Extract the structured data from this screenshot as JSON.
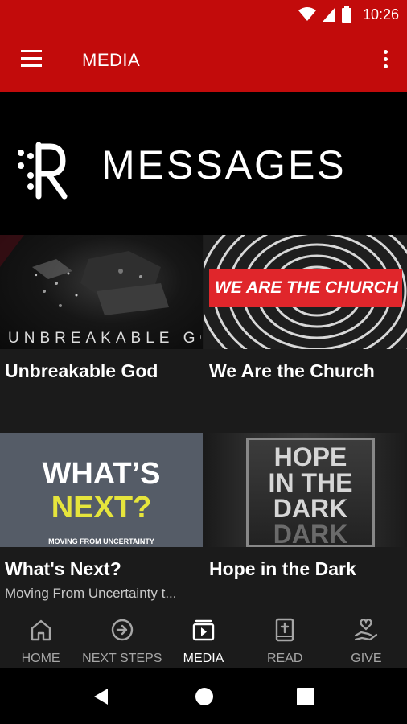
{
  "status_bar": {
    "time": "10:26",
    "bg_color": "#c20b0b"
  },
  "app_bar": {
    "title": "MEDIA",
    "menu_icon": "hamburger-menu-icon",
    "overflow_icon": "more-vert-icon",
    "bg_color": "#c20b0b"
  },
  "banner": {
    "logo": "R",
    "title": "MESSAGES"
  },
  "series": [
    {
      "title": "Unbreakable God",
      "subtitle": "",
      "art_text": "UNBREAKABLE GOD"
    },
    {
      "title": "We Are the Church",
      "subtitle": "",
      "art_text": "WE ARE THE CHURCH"
    },
    {
      "title": "What's Next?",
      "subtitle": "Moving From Uncertainty t...",
      "art_line1": "WHAT’S",
      "art_line2": "NEXT?",
      "art_caption": "MOVING FROM UNCERTAINTY"
    },
    {
      "title": "Hope in the Dark",
      "subtitle": "",
      "art_lines": [
        "HOPE",
        "IN THE",
        "DARK",
        "DARK"
      ]
    }
  ],
  "bottom_nav": {
    "items": [
      {
        "label": "HOME",
        "icon": "home-icon"
      },
      {
        "label": "NEXT STEPS",
        "icon": "arrow-circle-right-icon"
      },
      {
        "label": "MEDIA",
        "icon": "media-play-icon",
        "active": true
      },
      {
        "label": "READ",
        "icon": "bible-icon"
      },
      {
        "label": "GIVE",
        "icon": "give-hand-heart-icon"
      }
    ]
  },
  "system_nav": {
    "back_icon": "back-triangle-icon",
    "home_icon": "home-circle-icon",
    "recents_icon": "recents-square-icon"
  }
}
